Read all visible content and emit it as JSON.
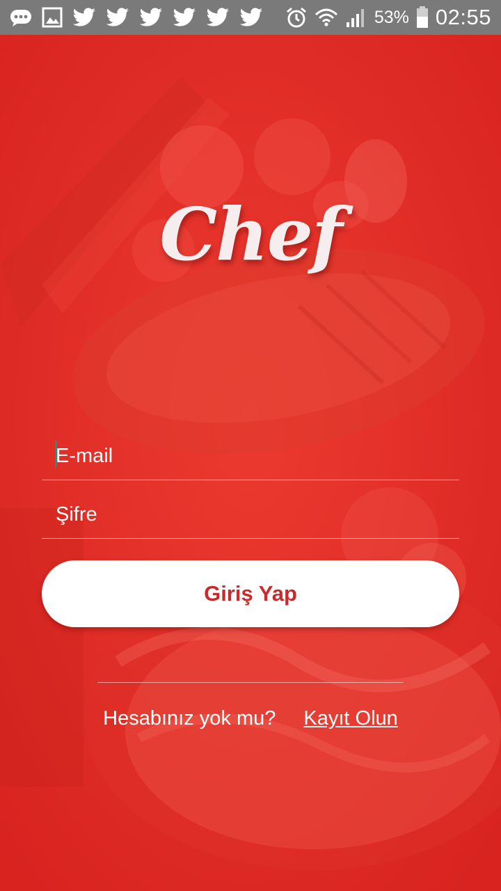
{
  "status_bar": {
    "battery": "53%",
    "time": "02:55",
    "icons": [
      "chat-bubble-icon",
      "gallery-icon",
      "twitter-icon",
      "twitter-icon",
      "twitter-icon",
      "twitter-icon",
      "twitter-icon",
      "twitter-icon",
      "alarm-icon",
      "wifi-icon",
      "signal-icon",
      "battery-icon"
    ]
  },
  "app": {
    "logo_text": "Chef",
    "accent_color": "#e7302b",
    "button_text_color": "#c92a2a"
  },
  "login_form": {
    "email_placeholder": "E-mail",
    "email_value": "",
    "password_placeholder": "Şifre",
    "password_value": "",
    "submit_label": "Giriş Yap"
  },
  "signup": {
    "prompt": "Hesabınız yok mu?",
    "link_label": "Kayıt Olun"
  }
}
